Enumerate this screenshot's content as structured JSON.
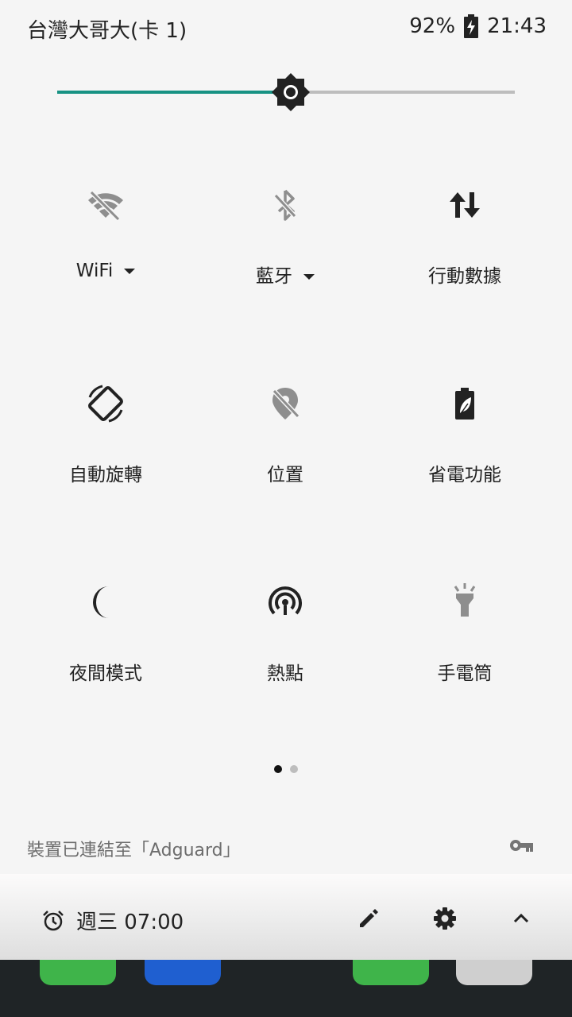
{
  "status_bar": {
    "carrier": "台灣大哥大(卡 1)",
    "battery_percent": "92%",
    "time": "21:43"
  },
  "brightness": {
    "level": 0.51,
    "accent_color": "#179283"
  },
  "tiles": [
    {
      "label": "WiFi",
      "icon": "wifi-off-icon",
      "has_dropdown": true,
      "active": false
    },
    {
      "label": "藍牙",
      "icon": "bluetooth-off-icon",
      "has_dropdown": true,
      "active": false
    },
    {
      "label": "行動數據",
      "icon": "mobile-data-icon",
      "has_dropdown": false,
      "active": true
    },
    {
      "label": "自動旋轉",
      "icon": "auto-rotate-icon",
      "has_dropdown": false,
      "active": true
    },
    {
      "label": "位置",
      "icon": "location-off-icon",
      "has_dropdown": false,
      "active": false
    },
    {
      "label": "省電功能",
      "icon": "battery-saver-icon",
      "has_dropdown": false,
      "active": true
    },
    {
      "label": "夜間模式",
      "icon": "night-mode-icon",
      "has_dropdown": false,
      "active": true
    },
    {
      "label": "熱點",
      "icon": "hotspot-icon",
      "has_dropdown": false,
      "active": true
    },
    {
      "label": "手電筒",
      "icon": "flashlight-icon",
      "has_dropdown": false,
      "active": false
    }
  ],
  "pagination": {
    "current": 1,
    "total": 2
  },
  "vpn": {
    "text": "裝置已連結至「Adguard」",
    "icon": "vpn-key-icon"
  },
  "footer": {
    "alarm_text": "週三 07:00",
    "alarm_icon": "alarm-clock-icon",
    "edit_icon": "pencil-icon",
    "settings_icon": "gear-icon",
    "collapse_icon": "chevron-up-icon"
  },
  "colors": {
    "icon_active": "#222222",
    "icon_inactive": "#8e8e8e",
    "background": "#f5f5f5"
  }
}
